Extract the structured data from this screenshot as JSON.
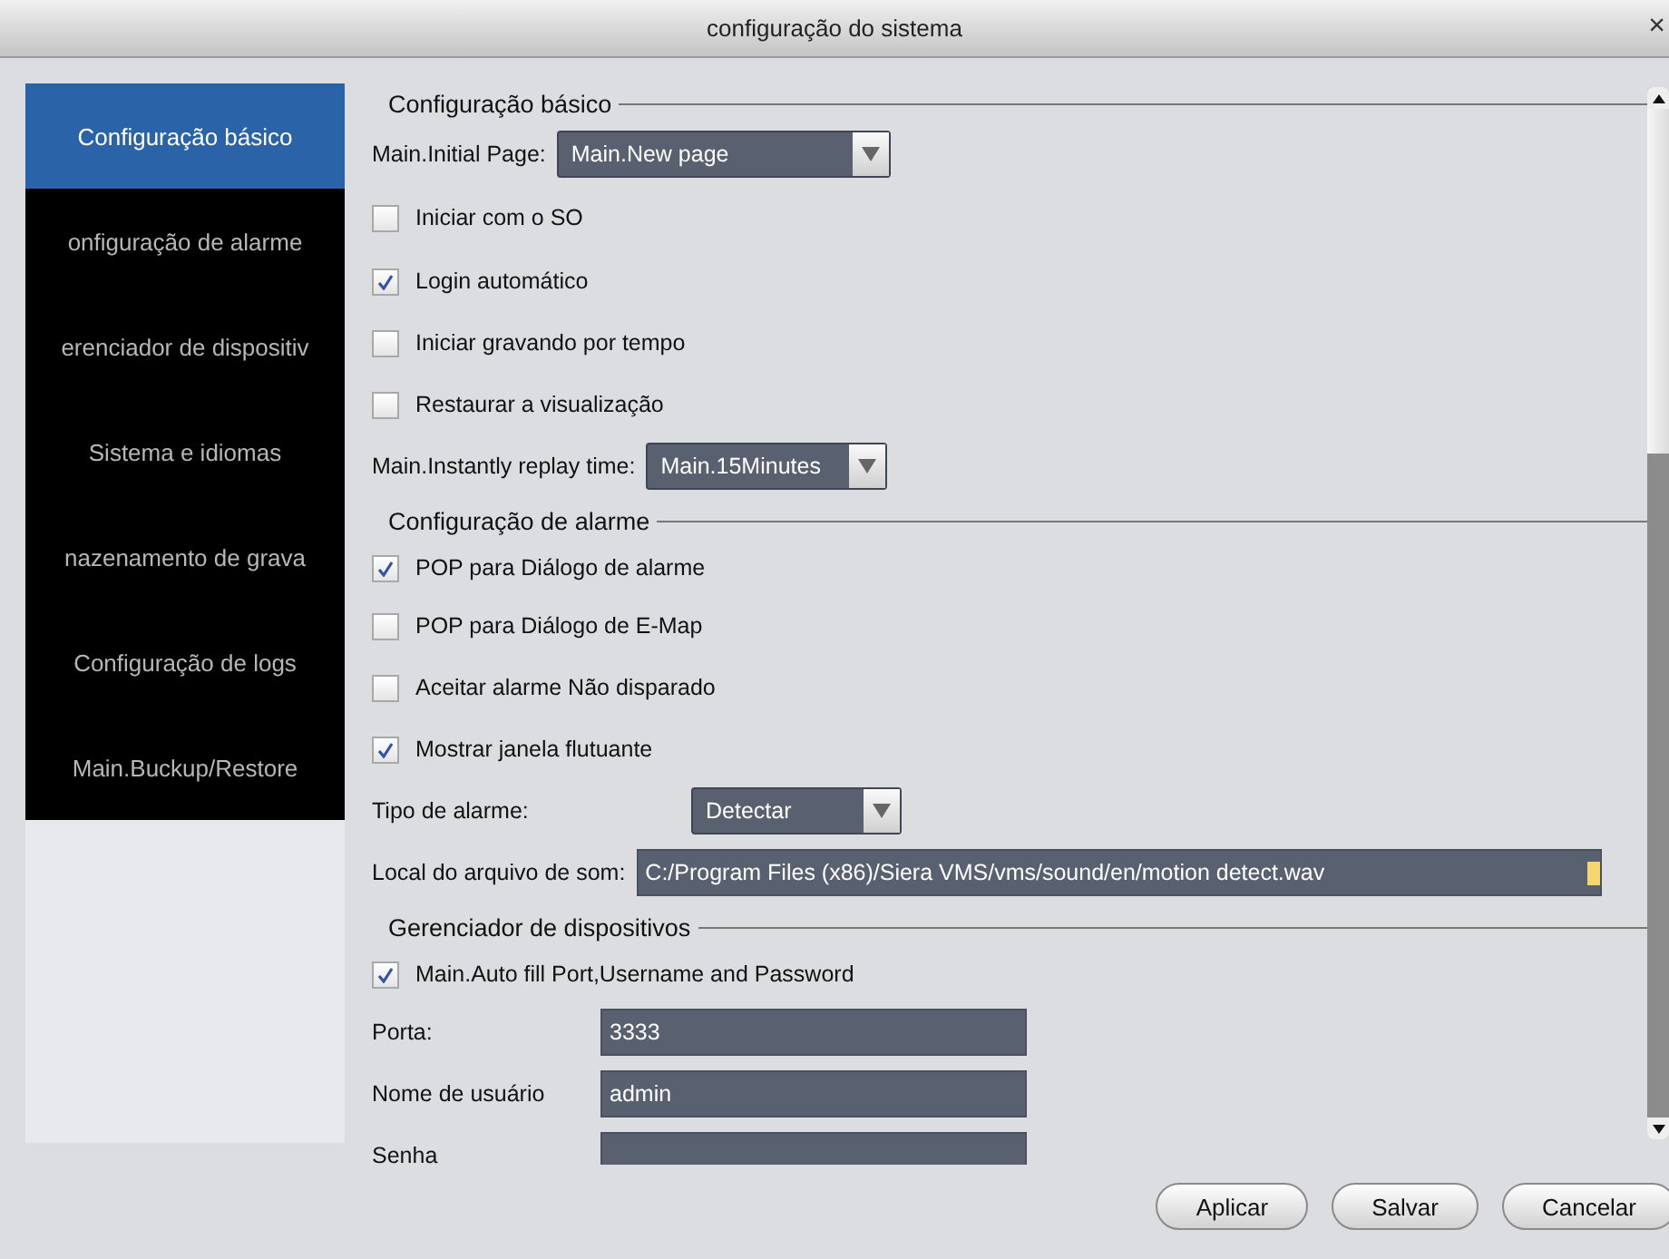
{
  "window": {
    "title": "configuração do sistema",
    "close": "×"
  },
  "sidebar": {
    "items": [
      {
        "label": "Configuração básico",
        "selected": true
      },
      {
        "label": "onfiguração de alarme",
        "selected": false
      },
      {
        "label": "erenciador de dispositiv",
        "selected": false
      },
      {
        "label": "Sistema e idiomas",
        "selected": false
      },
      {
        "label": "nazenamento de grava",
        "selected": false
      },
      {
        "label": "Configuração de logs",
        "selected": false
      },
      {
        "label": "Main.Buckup/Restore",
        "selected": false
      }
    ]
  },
  "sections": [
    {
      "title": "Configuração básico",
      "rows": [
        {
          "kind": "select",
          "label": "Main.Initial Page:",
          "value": "Main.New page"
        },
        {
          "kind": "checkbox",
          "label": "Iniciar com o SO",
          "checked": false
        },
        {
          "kind": "checkbox",
          "label": "Login automático",
          "checked": true
        },
        {
          "kind": "checkbox",
          "label": "Iniciar gravando por tempo",
          "checked": false
        },
        {
          "kind": "checkbox",
          "label": "Restaurar a visualização",
          "checked": false
        },
        {
          "kind": "select",
          "label": "Main.Instantly replay time:",
          "value": "Main.15Minutes"
        }
      ]
    },
    {
      "title": "Configuração de alarme",
      "rows": [
        {
          "kind": "checkbox",
          "label": "POP para Diálogo de alarme",
          "checked": true
        },
        {
          "kind": "checkbox",
          "label": "POP para Diálogo de E-Map",
          "checked": false
        },
        {
          "kind": "checkbox",
          "label": "Aceitar alarme Não disparado",
          "checked": false
        },
        {
          "kind": "checkbox",
          "label": "Mostrar janela flutuante",
          "checked": true
        },
        {
          "kind": "select",
          "label": "Tipo de alarme:",
          "value": "Detectar"
        },
        {
          "kind": "path",
          "label": "Local do arquivo de som:",
          "value": "C:/Program Files (x86)/Siera VMS/vms/sound/en/motion detect.wav"
        }
      ]
    },
    {
      "title": "Gerenciador de dispositivos",
      "rows": [
        {
          "kind": "checkbox",
          "label": "Main.Auto fill Port,Username and Password",
          "checked": true
        },
        {
          "kind": "text",
          "label": "Porta:",
          "value": "3333"
        },
        {
          "kind": "text",
          "label": "Nome de usuário",
          "value": "admin"
        },
        {
          "kind": "text",
          "label": "Senha",
          "value": ""
        }
      ]
    }
  ],
  "buttons": [
    "Aplicar",
    "Salvar",
    "Cancelar"
  ]
}
